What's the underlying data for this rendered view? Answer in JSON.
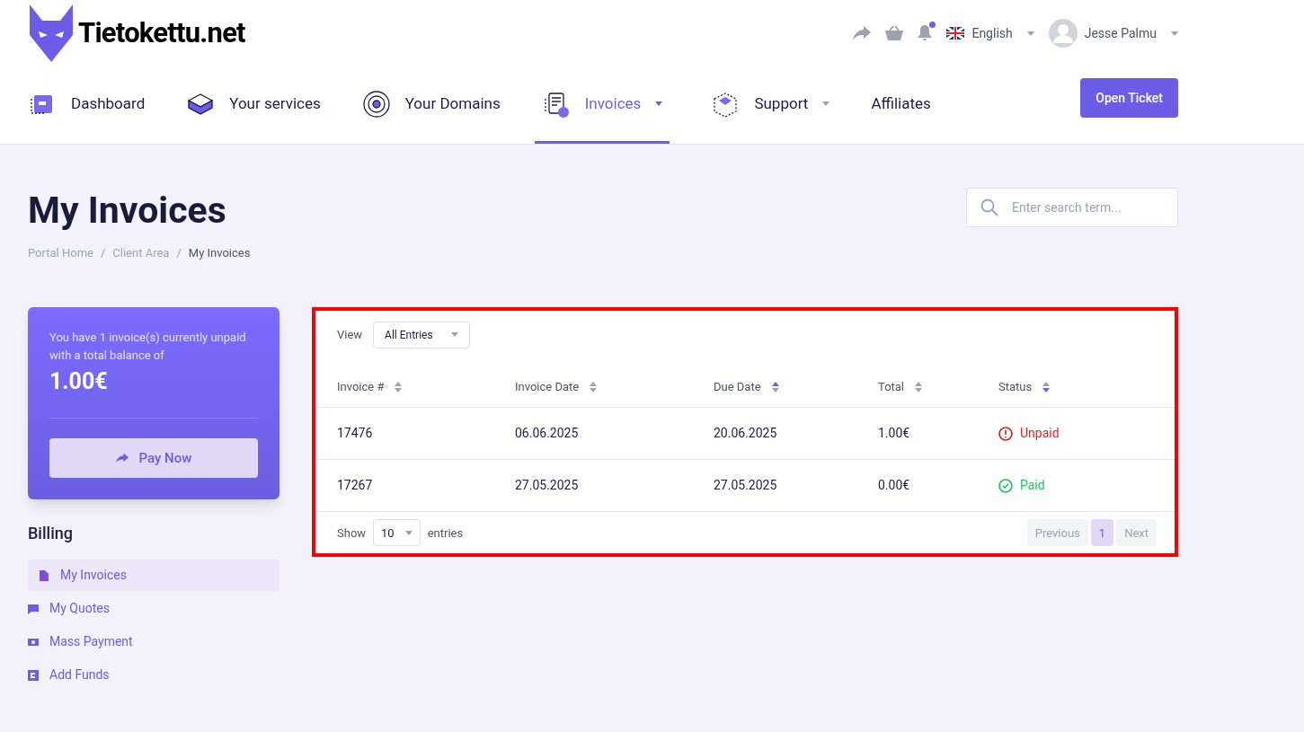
{
  "brand": {
    "name": "Tietokettu.net"
  },
  "topbar": {
    "language": "English",
    "user": "Jesse Palmu",
    "notification_dot": true
  },
  "nav": [
    {
      "label": "Dashboard",
      "kind": "dashboard",
      "selected": false,
      "dropdown": false
    },
    {
      "label": "Your services",
      "kind": "services",
      "selected": false,
      "dropdown": false
    },
    {
      "label": "Your Domains",
      "kind": "domains",
      "selected": false,
      "dropdown": false
    },
    {
      "label": "Invoices",
      "kind": "invoices",
      "selected": true,
      "dropdown": true
    },
    {
      "label": "Support",
      "kind": "support",
      "selected": false,
      "dropdown": true
    },
    {
      "label": "Affiliates",
      "kind": "plain",
      "selected": false,
      "dropdown": false
    }
  ],
  "open_ticket": "Open Ticket",
  "page": {
    "title": "My Invoices",
    "search_placeholder": "Enter search term...",
    "breadcrumb_separator": "/",
    "breadcrumb": [
      {
        "label": "Portal Home",
        "current": false
      },
      {
        "label": "Client Area",
        "current": false
      },
      {
        "label": "My Invoices",
        "current": true
      }
    ]
  },
  "balance_card": {
    "message": "You have 1 invoice(s) currently unpaid with a total balance of",
    "amount": "1.00€",
    "button": "Pay Now"
  },
  "billing": {
    "title": "Billing",
    "items": [
      {
        "label": "My Invoices",
        "kind": "file",
        "selected": true
      },
      {
        "label": "My Quotes",
        "kind": "comment",
        "selected": false
      },
      {
        "label": "Mass Payment",
        "kind": "money",
        "selected": false
      },
      {
        "label": "Add Funds",
        "kind": "funds",
        "selected": false
      }
    ]
  },
  "table": {
    "highlighted": true,
    "view_label": "View",
    "view_value": "All Entries",
    "columns": [
      {
        "label": "Invoice #",
        "sort_up": false,
        "sort_down": false
      },
      {
        "label": "Invoice Date",
        "sort_up": false,
        "sort_down": false
      },
      {
        "label": "Due Date",
        "sort_up": true,
        "sort_down": false
      },
      {
        "label": "Total",
        "sort_up": false,
        "sort_down": false
      },
      {
        "label": "Status",
        "sort_up": false,
        "sort_down": true
      }
    ],
    "rows": [
      {
        "cells": [
          "17476",
          "06.06.2025",
          "20.06.2025",
          "1.00€"
        ],
        "status": "Unpaid",
        "kind": "unpaid"
      },
      {
        "cells": [
          "17267",
          "27.05.2025",
          "27.05.2025",
          "0.00€"
        ],
        "status": "Paid",
        "kind": "paid"
      }
    ],
    "show_label": "Show",
    "page_size": "10",
    "entries_label": "entries",
    "pagination": [
      {
        "label": "Previous",
        "disabled": true,
        "selected": false
      },
      {
        "label": "1",
        "disabled": false,
        "selected": true
      },
      {
        "label": "Next",
        "disabled": true,
        "selected": false
      }
    ]
  }
}
